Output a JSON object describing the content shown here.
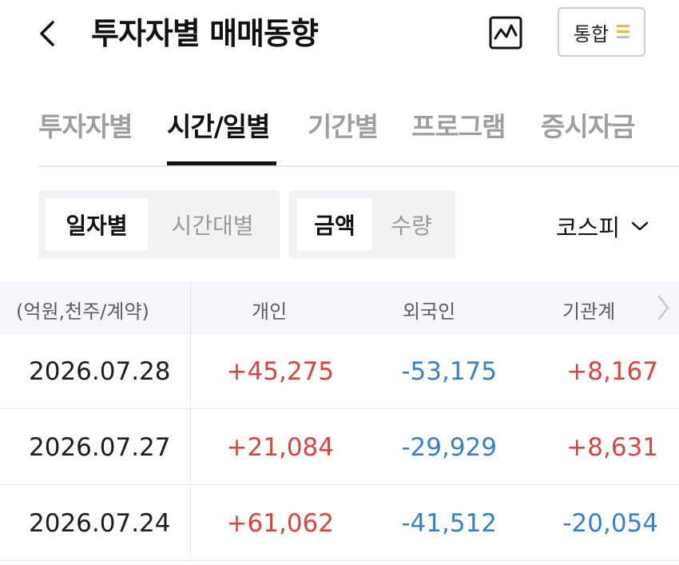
{
  "header": {
    "title": "투자자별 매매동향",
    "filter_label": "통합",
    "icons": {
      "back": "chevron-left-icon",
      "chart": "line-chart-icon",
      "menu": "menu-lines-icon"
    }
  },
  "tabs": [
    {
      "label": "투자자별",
      "active": false
    },
    {
      "label": "시간/일별",
      "active": true
    },
    {
      "label": "기간별",
      "active": false
    },
    {
      "label": "프로그램",
      "active": false
    },
    {
      "label": "증시자금",
      "active": false
    }
  ],
  "segments": {
    "period": {
      "options": [
        "일자별",
        "시간대별"
      ],
      "selected": "일자별"
    },
    "unit": {
      "options": [
        "금액",
        "수량"
      ],
      "selected": "금액"
    }
  },
  "market": {
    "label": "코스피"
  },
  "table": {
    "headers": [
      "(억원,천주/계약)",
      "개인",
      "외국인",
      "기관계"
    ],
    "rows": [
      {
        "date": "2026.07.28",
        "individual": "+45,275",
        "foreign": "-53,175",
        "institution": "+8,167"
      },
      {
        "date": "2026.07.27",
        "individual": "+21,084",
        "foreign": "-29,929",
        "institution": "+8,631"
      },
      {
        "date": "2026.07.24",
        "individual": "+61,062",
        "foreign": "-41,512",
        "institution": "-20,054"
      }
    ]
  },
  "colors": {
    "positive": "#d9443f",
    "negative": "#3b80c6",
    "menu_accent": "#f2b632"
  }
}
